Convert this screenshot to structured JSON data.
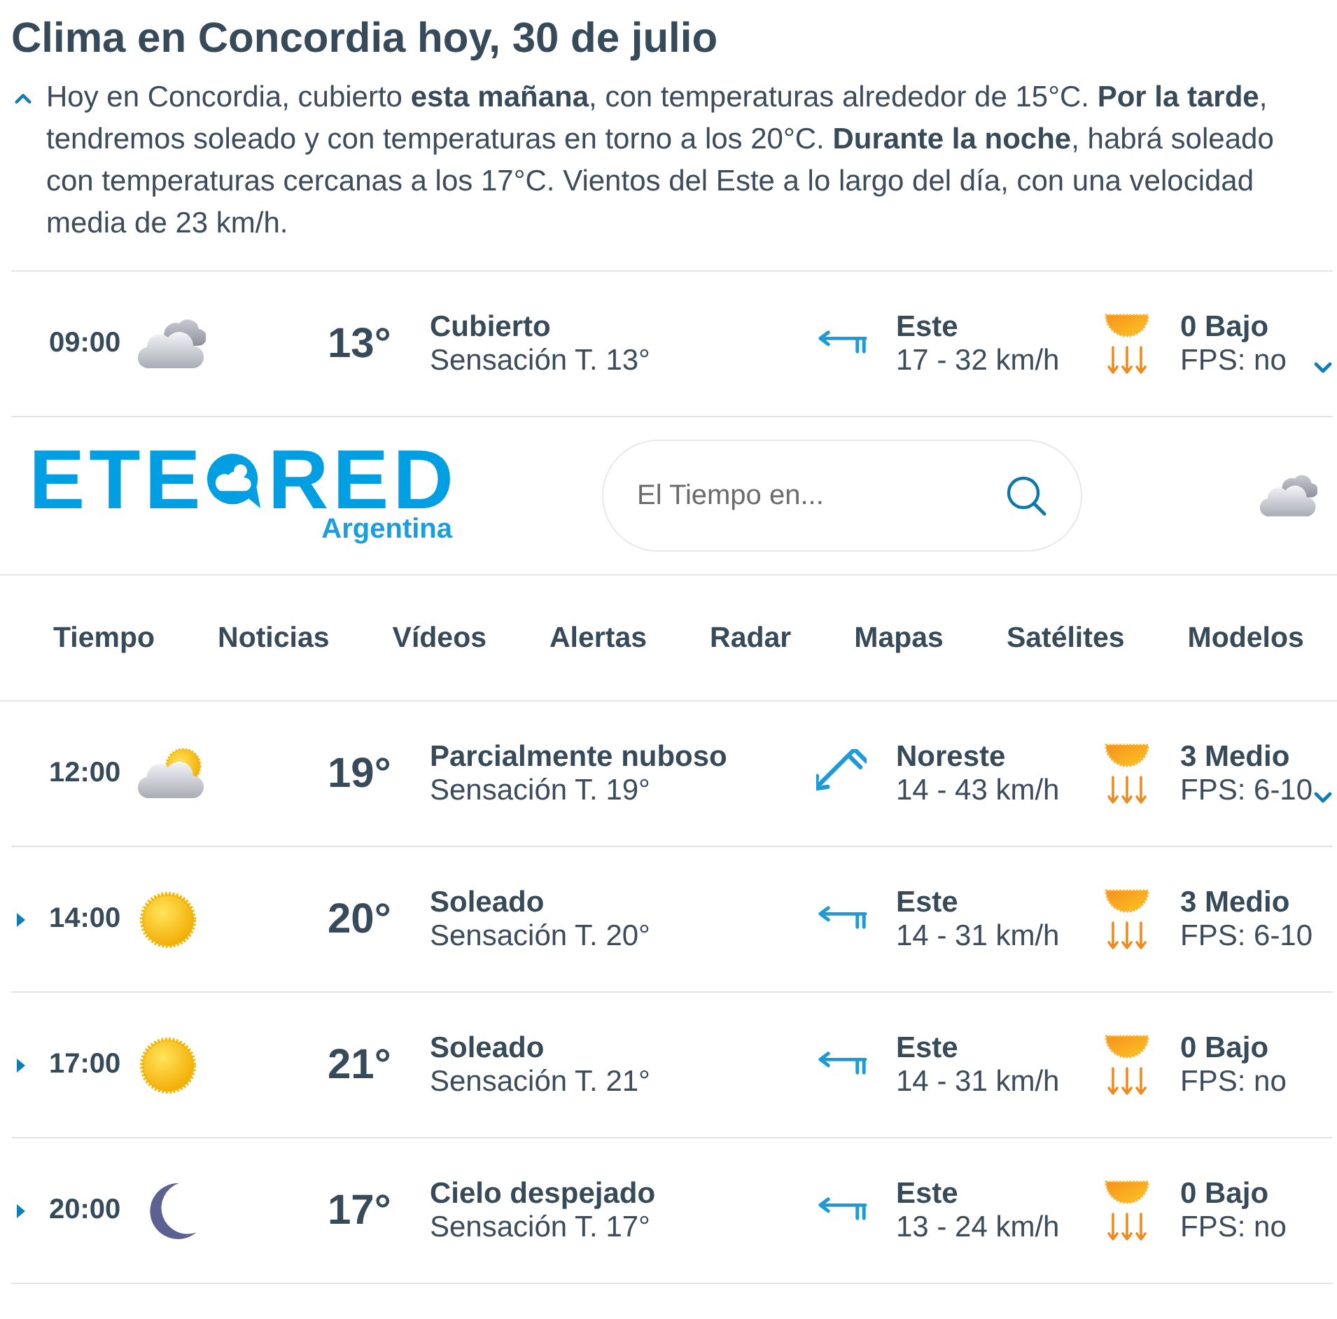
{
  "page_title": "Clima en Concordia hoy, 30 de julio",
  "summary": {
    "expanded": true,
    "text": "Hoy en Concordia, cubierto **esta mañana**, con temperaturas alrededor de 15°C. **Por la tarde**, tendremos soleado y con temperaturas en torno a los 20°C. **Durante la noche**, habrá soleado con temperaturas cercanas a los 17°C. Vientos del Este a lo largo del día, con una velocidad media de 23 km/h."
  },
  "hourly": [
    {
      "time": "09:00",
      "toggle": {
        "kind": "chevron"
      },
      "sky": {
        "kind": "cloudy"
      },
      "temperature": "13°",
      "condition": "Cubierto",
      "feels_like": "Sensación T. 13°",
      "wind": {
        "kind": "east",
        "direction": "Este",
        "speed": "17 - 32 km/h"
      },
      "uv": {
        "index": "0 Bajo",
        "protection": "FPS: no"
      }
    }
  ],
  "site_header": {
    "logo": {
      "left": "ETE",
      "right": "RED",
      "region": "Argentina"
    },
    "search": {
      "placeholder": "El Tiempo en..."
    },
    "current_weather": {
      "kind": "cloudy"
    },
    "nav": [
      "Tiempo",
      "Noticias",
      "Vídeos",
      "Alertas",
      "Radar",
      "Mapas",
      "Satélites",
      "Modelos"
    ]
  },
  "hourly_continued": [
    {
      "time": "12:00",
      "toggle": {
        "kind": "chevron"
      },
      "sky": {
        "kind": "partly_cloudy"
      },
      "temperature": "19°",
      "condition": "Parcialmente nuboso",
      "feels_like": "Sensación T. 19°",
      "wind": {
        "kind": "northeast",
        "direction": "Noreste",
        "speed": "14 - 43 km/h"
      },
      "uv": {
        "index": "3 Medio",
        "protection": "FPS: 6-10"
      }
    },
    {
      "time": "14:00",
      "toggle": {
        "kind": "triangle"
      },
      "sky": {
        "kind": "sunny"
      },
      "temperature": "20°",
      "condition": "Soleado",
      "feels_like": "Sensación T. 20°",
      "wind": {
        "kind": "east",
        "direction": "Este",
        "speed": "14 - 31 km/h"
      },
      "uv": {
        "index": "3 Medio",
        "protection": "FPS: 6-10"
      }
    },
    {
      "time": "17:00",
      "toggle": {
        "kind": "triangle"
      },
      "sky": {
        "kind": "sunny"
      },
      "temperature": "21°",
      "condition": "Soleado",
      "feels_like": "Sensación T. 21°",
      "wind": {
        "kind": "east",
        "direction": "Este",
        "speed": "14 - 31 km/h"
      },
      "uv": {
        "index": "0 Bajo",
        "protection": "FPS: no"
      }
    },
    {
      "time": "20:00",
      "toggle": {
        "kind": "triangle"
      },
      "sky": {
        "kind": "clear_night"
      },
      "temperature": "17°",
      "condition": "Cielo despejado",
      "feels_like": "Sensación T. 17°",
      "wind": {
        "kind": "east",
        "direction": "Este",
        "speed": "13 - 24 km/h"
      },
      "uv": {
        "index": "0 Bajo",
        "protection": "FPS: no"
      }
    }
  ]
}
